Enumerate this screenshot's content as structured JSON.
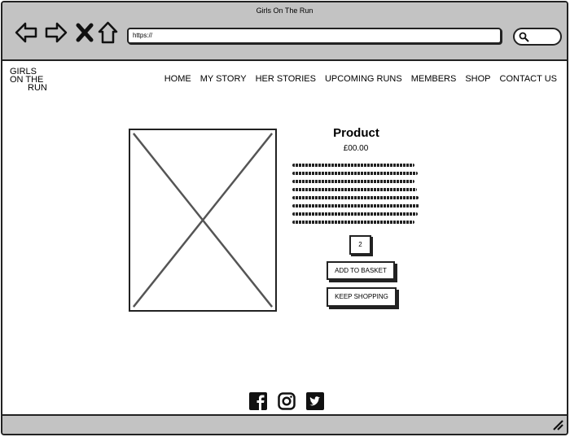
{
  "window": {
    "title": "Girls On The Run"
  },
  "browser": {
    "url": "https://"
  },
  "site": {
    "logo_lines": [
      "GIRLS",
      "ON THE",
      "RUN"
    ],
    "nav": [
      "HOME",
      "MY STORY",
      "HER STORIES",
      "UPCOMING RUNS",
      "MEMBERS",
      "SHOP",
      "CONTACT US"
    ]
  },
  "product": {
    "title": "Product",
    "price": "£00.00",
    "quantity": "2",
    "add_label": "ADD TO BASKET",
    "keep_label": "KEEP SHOPPING"
  },
  "icons": {
    "back": "arrow-left-icon",
    "forward": "arrow-right-icon",
    "stop": "close-icon",
    "home": "home-icon",
    "search": "search-icon",
    "facebook": "facebook-icon",
    "instagram": "instagram-icon",
    "twitter": "twitter-icon"
  }
}
